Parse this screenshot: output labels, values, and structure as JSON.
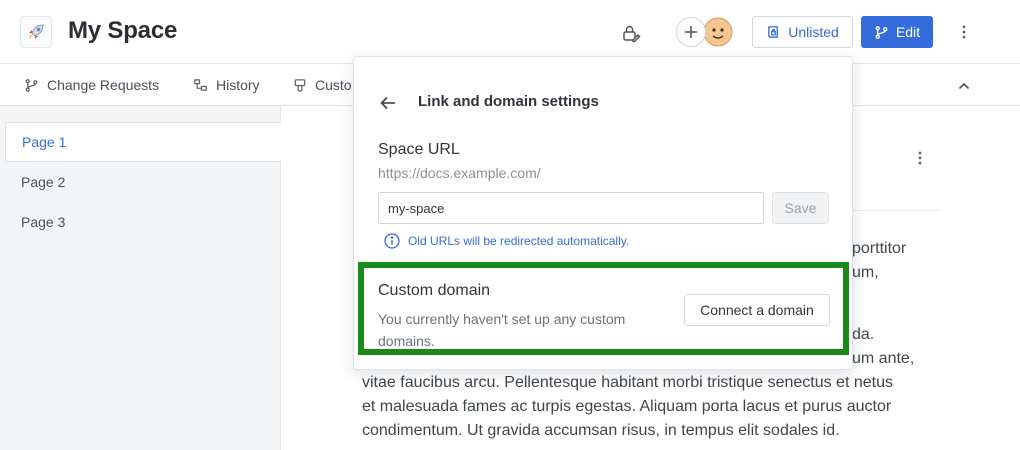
{
  "header": {
    "space_title": "My Space",
    "unlisted_label": "Unlisted",
    "edit_label": "Edit"
  },
  "tabs": [
    {
      "label": "Change Requests",
      "icon": "branch-icon"
    },
    {
      "label": "History",
      "icon": "history-icon"
    },
    {
      "label": "Custo",
      "icon": "customize-icon"
    }
  ],
  "sidebar": {
    "pages": [
      {
        "label": "Page 1",
        "active": true
      },
      {
        "label": "Page 2",
        "active": false
      },
      {
        "label": "Page 3",
        "active": false
      }
    ]
  },
  "content": {
    "lines": [
      "porttitor",
      "um,",
      "da.",
      "um ante,",
      "vitae faucibus arcu. Pellentesque habitant morbi tristique senectus et netus",
      "et malesuada fames ac turpis egestas. Aliquam porta lacus et purus auctor",
      "condimentum. Ut gravida accumsan risus, in tempus elit sodales id."
    ]
  },
  "popover": {
    "title": "Link and domain settings",
    "space_url_label": "Space URL",
    "base_url": "https://docs.example.com/",
    "slug_value": "my-space",
    "save_label": "Save",
    "redirect_note": "Old URLs will be redirected automatically.",
    "custom_domain": {
      "title": "Custom domain",
      "description": "You currently haven't set up any custom domains.",
      "connect_label": "Connect a domain"
    }
  },
  "colors": {
    "accent": "#346ddb",
    "highlight_border": "#1a8a1a",
    "sidebar_bg": "#f4f5f7"
  }
}
